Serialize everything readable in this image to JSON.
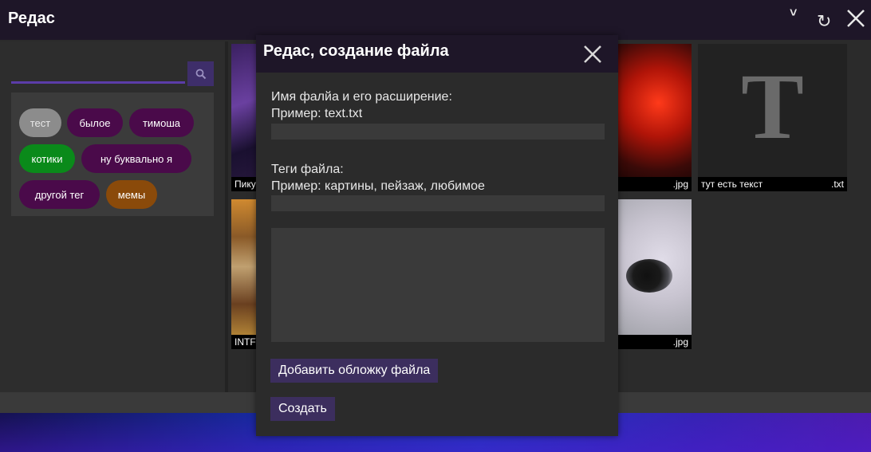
{
  "app": {
    "title": "Редас",
    "collapse_glyph": "˅",
    "refresh_glyph": "↻"
  },
  "search": {
    "value": "",
    "placeholder": ""
  },
  "tags": [
    {
      "label": "тест",
      "color": "#8c8c8c"
    },
    {
      "label": "былое",
      "color": "#4a0a4a"
    },
    {
      "label": "тимоша",
      "color": "#4a0a4a"
    },
    {
      "label": "котики",
      "color": "#0a8a1a"
    },
    {
      "label": "ну буквально я",
      "color": "#4a0a4a"
    },
    {
      "label": "другой тег",
      "color": "#4a0a4a"
    },
    {
      "label": "мемы",
      "color": "#8a4a0a"
    }
  ],
  "files": [
    {
      "name": "Пику",
      "ext": ""
    },
    {
      "name": "",
      "ext": ".jpg"
    },
    {
      "name": "тут есть текст",
      "ext": ".txt",
      "letter": "T"
    },
    {
      "name": "INTF",
      "ext": ""
    },
    {
      "name": "",
      "ext": ".jpg"
    }
  ],
  "dialog": {
    "title": "Редас, создание файла",
    "name_label": "Имя фалйа и его расширение:",
    "name_example": "Пример: text.txt",
    "name_value": "",
    "tags_label": "Теги файла:",
    "tags_example": "Пример: картины, пейзаж, любимое",
    "tags_value": "",
    "content_value": "",
    "cover_button": "Добавить обложку файла",
    "create_button": "Создать"
  },
  "colors": {
    "accent": "#5b3ca8",
    "titlebar": "#1e1628",
    "button": "#3c2e5e"
  }
}
